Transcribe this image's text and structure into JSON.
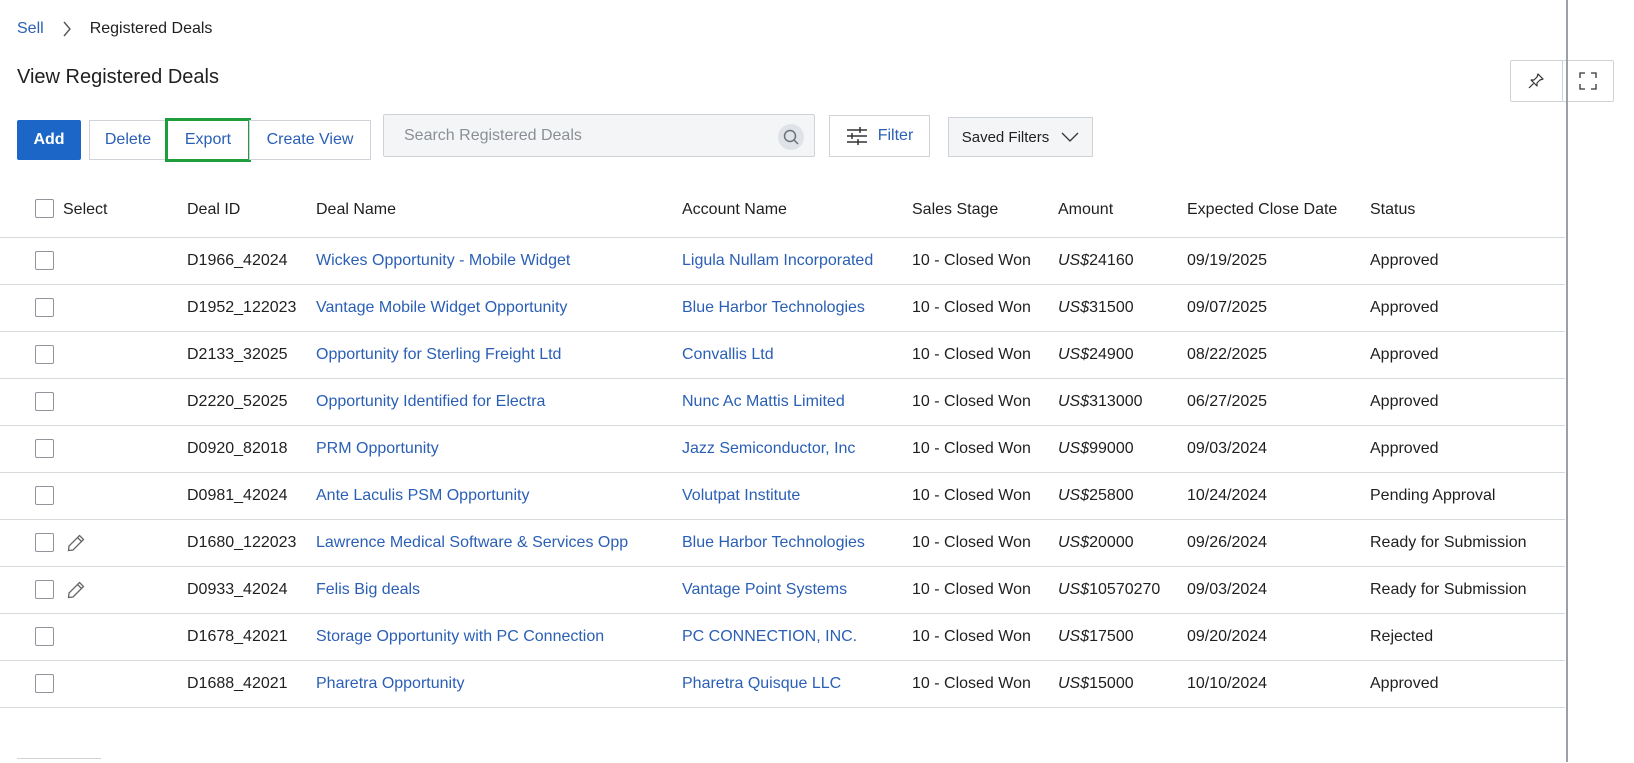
{
  "breadcrumb": {
    "parent": "Sell",
    "current": "Registered Deals"
  },
  "page_title": "View Registered Deals",
  "toolbar": {
    "add_label": "Add",
    "delete_label": "Delete",
    "export_label": "Export",
    "create_view_label": "Create View",
    "search_placeholder": "Search Registered Deals",
    "filter_label": "Filter",
    "saved_filters_label": "Saved Filters"
  },
  "icons": {
    "pin": "pin-icon",
    "expand": "fullscreen-icon",
    "search": "search-icon",
    "filter": "sliders-icon",
    "dropdown": "chevron-down-icon",
    "edit": "pencil-icon",
    "breadcrumb_sep": "chevron-right-icon"
  },
  "colors": {
    "primary": "#1b66c6",
    "link": "#2a5fb5",
    "highlight": "#1f9d3d"
  },
  "table": {
    "headers": {
      "select": "Select",
      "deal_id": "Deal ID",
      "deal_name": "Deal Name",
      "account_name": "Account Name",
      "sales_stage": "Sales Stage",
      "amount": "Amount",
      "close_date": "Expected Close Date",
      "status": "Status"
    },
    "currency": "US$",
    "rows": [
      {
        "id": "D1966_42024",
        "name": "Wickes Opportunity - Mobile Widget",
        "account": "Ligula Nullam Incorporated",
        "stage": "10 - Closed Won",
        "amount": "24160",
        "date": "09/19/2025",
        "status": "Approved",
        "editable": false
      },
      {
        "id": "D1952_122023",
        "name": "Vantage Mobile Widget Opportunity",
        "account": "Blue Harbor Technologies",
        "stage": "10 - Closed Won",
        "amount": "31500",
        "date": "09/07/2025",
        "status": "Approved",
        "editable": false
      },
      {
        "id": "D2133_32025",
        "name": "Opportunity for Sterling Freight Ltd",
        "account": "Convallis Ltd",
        "stage": "10 - Closed Won",
        "amount": "24900",
        "date": "08/22/2025",
        "status": "Approved",
        "editable": false
      },
      {
        "id": "D2220_52025",
        "name": "Opportunity Identified for Electra",
        "account": "Nunc Ac Mattis Limited",
        "stage": "10 - Closed Won",
        "amount": "313000",
        "date": "06/27/2025",
        "status": "Approved",
        "editable": false
      },
      {
        "id": "D0920_82018",
        "name": "PRM Opportunity",
        "account": "Jazz Semiconductor, Inc",
        "stage": "10 - Closed Won",
        "amount": "99000",
        "date": "09/03/2024",
        "status": "Approved",
        "editable": false
      },
      {
        "id": "D0981_42024",
        "name": "Ante Laculis PSM Opportunity",
        "account": "Volutpat Institute",
        "stage": "10 - Closed Won",
        "amount": "25800",
        "date": "10/24/2024",
        "status": "Pending Approval",
        "editable": false
      },
      {
        "id": "D1680_122023",
        "name": "Lawrence Medical Software & Services Opp",
        "account": "Blue Harbor Technologies",
        "stage": "10 - Closed Won",
        "amount": "20000",
        "date": "09/26/2024",
        "status": "Ready for Submission",
        "editable": true
      },
      {
        "id": "D0933_42024",
        "name": "Felis Big deals",
        "account": "Vantage Point Systems",
        "stage": "10 - Closed Won",
        "amount": "10570270",
        "date": "09/03/2024",
        "status": "Ready for Submission",
        "editable": true
      },
      {
        "id": "D1678_42021",
        "name": "Storage Opportunity with PC Connection",
        "account": "PC CONNECTION, INC.",
        "stage": "10 - Closed Won",
        "amount": "17500",
        "date": "09/20/2024",
        "status": "Rejected",
        "editable": false
      },
      {
        "id": "D1688_42021",
        "name": "Pharetra Opportunity",
        "account": "Pharetra Quisque LLC",
        "stage": "10 - Closed Won",
        "amount": "15000",
        "date": "10/10/2024",
        "status": "Approved",
        "editable": false
      }
    ]
  }
}
